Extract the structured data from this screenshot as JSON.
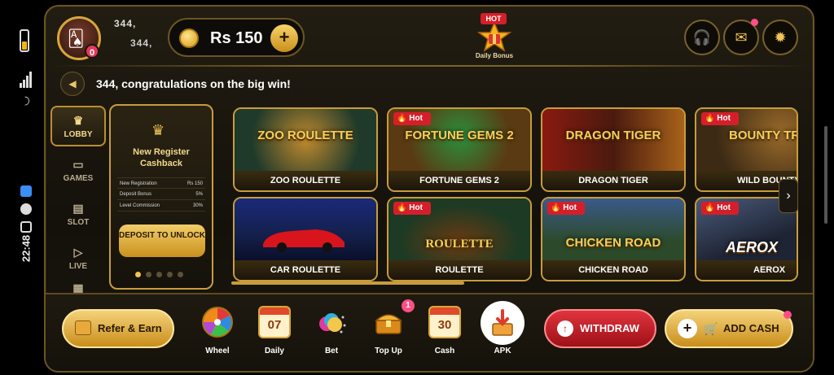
{
  "status": {
    "time": "22:48"
  },
  "header": {
    "user_name": "344,",
    "user_id": "344,",
    "avatar_badge": "0",
    "balance": "Rs 150",
    "add_label": "+",
    "daily_bonus": {
      "tag": "HOT",
      "label": "Daily Bonus"
    }
  },
  "marquee": {
    "text": "344, congratulations on the big win!"
  },
  "nav": [
    {
      "label": "LOBBY",
      "icon": "crown-icon",
      "active": true
    },
    {
      "label": "GAMES",
      "icon": "gamepad-icon"
    },
    {
      "label": "SLOT",
      "icon": "slot-machine-icon"
    },
    {
      "label": "LIVE",
      "icon": "play-icon"
    }
  ],
  "promo": {
    "title": "New Register Cashback",
    "rows": [
      {
        "k": "New Registration",
        "v": "Rs 150"
      },
      {
        "k": "Deposit Bonus",
        "v": "5%"
      },
      {
        "k": "Level Commission",
        "v": "30%"
      }
    ],
    "button": "DEPOSIT TO UNLOCK"
  },
  "games": [
    {
      "name": "ZOO ROULETTE",
      "art": "ZOO ROULETTE",
      "hot": false,
      "bg": "#1f3a2a"
    },
    {
      "name": "FORTUNE GEMS 2",
      "art": "FORTUNE GEMS 2",
      "hot": true,
      "bg": "#5a3a12"
    },
    {
      "name": "DRAGON TIGER",
      "art": "DRAGON TIGER",
      "hot": false,
      "bg": "#4a1a0e"
    },
    {
      "name": "WILD BOUNTY",
      "art": "BOUNTY TRA",
      "hot": true,
      "bg": "#3c2a14"
    },
    {
      "name": "CAR ROULETTE",
      "art": "",
      "hot": false,
      "bg": "#14204a"
    },
    {
      "name": "ROULETTE",
      "art": "ROULETTE",
      "hot": true,
      "bg": "#1d3a24"
    },
    {
      "name": "CHICKEN ROAD",
      "art": "CHICKEN ROAD",
      "hot": true,
      "bg": "#2c4a2a"
    },
    {
      "name": "AEROX",
      "art": "AEROX",
      "hot": true,
      "bg": "#1e2433"
    }
  ],
  "hot_label": "Hot",
  "bottom": {
    "refer": "Refer & Earn",
    "tools": [
      {
        "label": "Wheel",
        "icon": "wheel-icon"
      },
      {
        "label": "Daily",
        "icon": "calendar-icon",
        "num": "07"
      },
      {
        "label": "Bet",
        "icon": "coins-icon"
      },
      {
        "label": "Top Up",
        "icon": "treasure-icon",
        "badge": "1"
      },
      {
        "label": "Cash",
        "icon": "calendar-icon",
        "num": "30"
      },
      {
        "label": "APK",
        "icon": "download-icon"
      }
    ],
    "withdraw": "WITHDRAW",
    "add_cash": "ADD CASH"
  },
  "colors": {
    "gold": "#c79d3b",
    "accent": "#f0c457",
    "red": "#d41f2a",
    "badge": "#ff4e86"
  }
}
